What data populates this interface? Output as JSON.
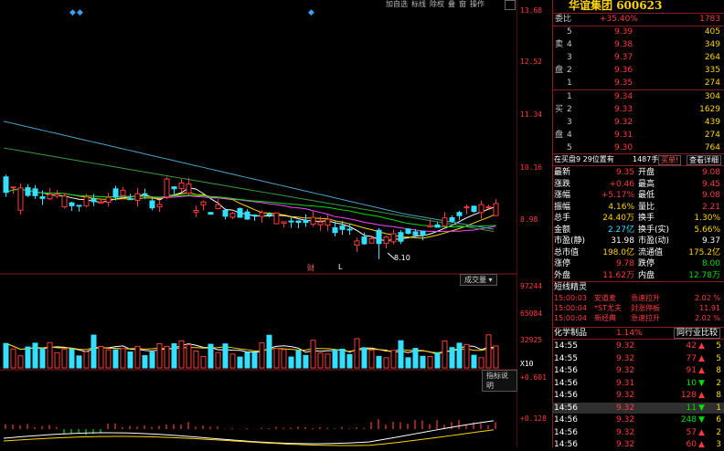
{
  "toolbar": {
    "items": [
      "加自选",
      "标线",
      "除权",
      "叠",
      "窗",
      "操作"
    ],
    "box_label": "▢"
  },
  "price_axis": [
    "13.68",
    "12.52",
    "11.34",
    "10.16",
    "8.98"
  ],
  "volume_axis": [
    "97244",
    "65084",
    "32925",
    "X10"
  ],
  "macd_axis": [
    "+0.601",
    "+0.128"
  ],
  "markers": {
    "low_label": "8.10",
    "event_r": "财",
    "event_l": "L"
  },
  "buttons": {
    "volume": "成交量",
    "indicator_help": "指标说明"
  },
  "stock": {
    "name": "华谊集团",
    "code": "600623"
  },
  "commission": {
    "label": "委比",
    "ratio": "+35.40%",
    "diff": "1783"
  },
  "orderbook": {
    "sell_label_1": "卖",
    "sell_label_2": "盘",
    "buy_label_1": "买",
    "buy_label_2": "盘",
    "sells": [
      {
        "idx": "5",
        "price": "9.39",
        "vol": "405"
      },
      {
        "idx": "4",
        "price": "9.38",
        "vol": "349"
      },
      {
        "idx": "3",
        "price": "9.37",
        "vol": "264"
      },
      {
        "idx": "2",
        "price": "9.36",
        "vol": "335"
      },
      {
        "idx": "1",
        "price": "9.35",
        "vol": "274"
      }
    ],
    "buys": [
      {
        "idx": "1",
        "price": "9.34",
        "vol": "304"
      },
      {
        "idx": "2",
        "price": "9.33",
        "vol": "1629"
      },
      {
        "idx": "3",
        "price": "9.32",
        "vol": "439"
      },
      {
        "idx": "4",
        "price": "9.31",
        "vol": "274"
      },
      {
        "idx": "5",
        "price": "9.30",
        "vol": "764"
      }
    ]
  },
  "buy_info": {
    "left": "在买盘9 29位置有",
    "mid": "1487手",
    "btn": "买单!",
    "right": "查看详细"
  },
  "quote": [
    {
      "l1": "最新",
      "v1": "9.35",
      "l2": "开盘",
      "v2": "9.08",
      "c1": "red",
      "c2": "red"
    },
    {
      "l1": "涨跌",
      "v1": "+0.46",
      "l2": "最高",
      "v2": "9.45",
      "c1": "red",
      "c2": "red"
    },
    {
      "l1": "涨幅",
      "v1": "+5.17%",
      "l2": "最低",
      "v2": "9.08",
      "c1": "red",
      "c2": "red"
    },
    {
      "l1": "振幅",
      "v1": "4.16%",
      "l2": "量比",
      "v2": "2.21",
      "c1": "yellow",
      "c2": "red"
    },
    {
      "l1": "总手",
      "v1": "24.40万",
      "l2": "换手",
      "v2": "1.30%",
      "c1": "yellow",
      "c2": "yellow"
    },
    {
      "l1": "金额",
      "v1": "2.27亿",
      "l2": "换手(实)",
      "v2": "5.66%",
      "c1": "cyan",
      "c2": "yellow"
    },
    {
      "l1": "市盈(静)",
      "v1": "31.98",
      "l2": "市盈(动)",
      "v2": "9.37",
      "c1": "white",
      "c2": "white"
    },
    {
      "l1": "总市值",
      "v1": "198.0亿",
      "l2": "流通值",
      "v2": "175.2亿",
      "c1": "yellow",
      "c2": "yellow"
    },
    {
      "l1": "涨停",
      "v1": "9.78",
      "l2": "跌停",
      "v2": "8.00",
      "c1": "red",
      "c2": "green"
    },
    {
      "l1": "外盘",
      "v1": "11.62万",
      "l2": "内盘",
      "v2": "12.78万",
      "c1": "red",
      "c2": "green"
    }
  ],
  "elves": {
    "title": "短线精灵",
    "rows": [
      {
        "time": "15:00:03",
        "name": "安道麦",
        "type": "急速拉升",
        "val": "2.02 %"
      },
      {
        "time": "15:00:04",
        "name": "*ST尤夫",
        "type": "封涨停板",
        "val": "11.91"
      },
      {
        "time": "15:00:04",
        "name": "新经典",
        "type": "急速拉升",
        "val": "2.02 %"
      }
    ]
  },
  "sector": {
    "name": "化学制品",
    "pct": "1.14%",
    "btn": "同行业比较"
  },
  "ticks": [
    {
      "t": "14:55",
      "p": "9.32",
      "v": "42",
      "d": "up",
      "e": "5"
    },
    {
      "t": "14:55",
      "p": "9.32",
      "v": "77",
      "d": "up",
      "e": "5"
    },
    {
      "t": "14:56",
      "p": "9.32",
      "v": "91",
      "d": "up",
      "e": "8"
    },
    {
      "t": "14:56",
      "p": "9.31",
      "v": "10",
      "d": "down",
      "e": "2"
    },
    {
      "t": "14:56",
      "p": "9.32",
      "v": "128",
      "d": "up",
      "e": "8"
    },
    {
      "t": "14:56",
      "p": "9.32",
      "v": "11",
      "d": "down",
      "e": "1"
    },
    {
      "t": "14:56",
      "p": "9.32",
      "v": "248",
      "d": "down",
      "e": "6"
    },
    {
      "t": "14:56",
      "p": "9.32",
      "v": "57",
      "d": "up",
      "e": "2"
    },
    {
      "t": "14:56",
      "p": "9.32",
      "v": "60",
      "d": "up",
      "e": "3"
    }
  ]
}
